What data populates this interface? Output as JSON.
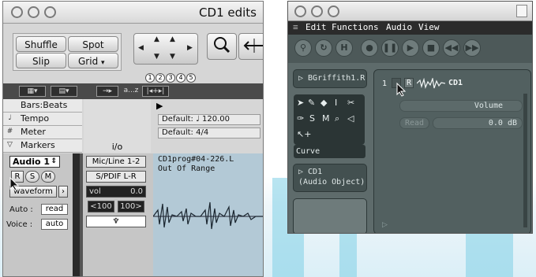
{
  "left_window": {
    "title": "CD1 edits",
    "edit_modes": {
      "shuffle": "Shuffle",
      "spot": "Spot",
      "slip": "Slip",
      "grid": "Grid"
    },
    "counter_digits": [
      "1",
      "2",
      "3",
      "4",
      "5"
    ],
    "toolbar": {
      "view_toggle_a": "▦▾",
      "view_toggle_b": "▤▾",
      "nudge": "→▸",
      "sort": "a...z",
      "link": "|◂+▸|"
    },
    "rulers": [
      {
        "icon": "",
        "label": "Bars:Beats"
      },
      {
        "icon": "tempo-icon",
        "label": "Tempo"
      },
      {
        "icon": "meter-icon",
        "label": "Meter"
      },
      {
        "icon": "marker-icon",
        "label": "Markers"
      }
    ],
    "io_header": "i/o",
    "tempo_field": "Default: ♩ 120.00",
    "meter_field": "Default: 4/4",
    "track": {
      "name": "Audio 1",
      "record": "R",
      "solo": "S",
      "mute": "M",
      "view": "waveform",
      "auto_label": "Auto :",
      "auto_value": "read",
      "voice_label": "Voice :",
      "voice_value": "auto",
      "input": "Mic/Line 1-2",
      "output": "S/PDIF L-R",
      "vol_label": "vol",
      "vol_value": "0.0",
      "pan_left": "<100",
      "pan_right": "100>",
      "clip_name": "CD1prog#04-226.L",
      "clip_status": "Out Of Range"
    }
  },
  "right_window": {
    "menu": [
      "Edit",
      "Functions",
      "Audio",
      "View"
    ],
    "region_name": "▷ BGriffith1.R",
    "curve_label": "Curve",
    "object_name": "▷ CD1",
    "object_type": "(Audio Object)",
    "channel_num": "1",
    "channel_name": "CD1",
    "automation_param": "Volume",
    "read_label": "Read",
    "volume_value": "0.0 dB"
  },
  "colors": {
    "logic_bg": "#5e6b6b",
    "pt_bg": "#d6d6d6",
    "clip_bg": "#b3c9d6"
  }
}
